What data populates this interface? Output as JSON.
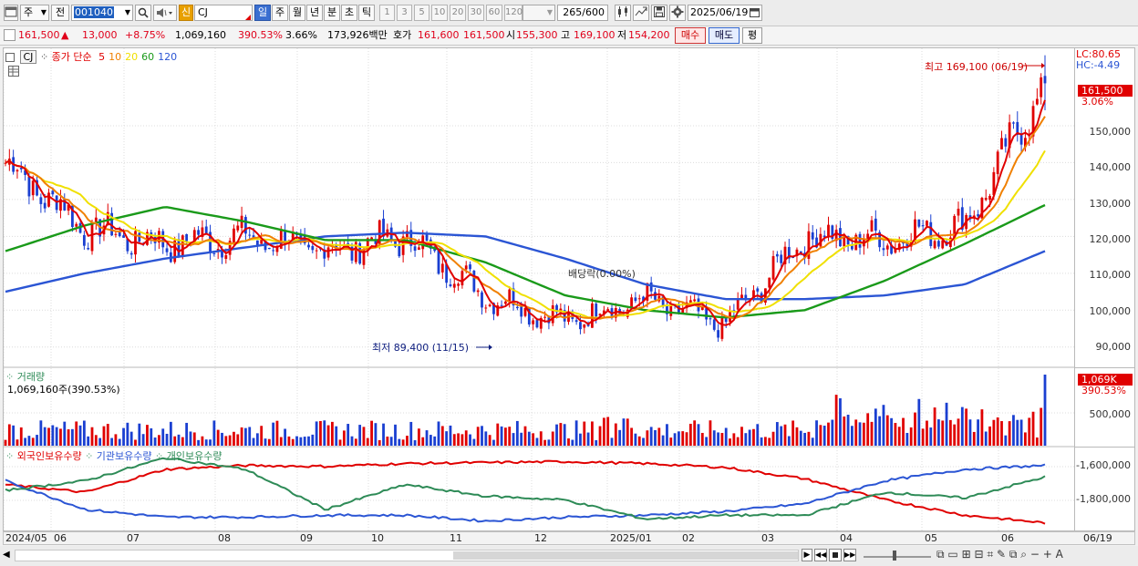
{
  "toolbar": {
    "market_type": "주",
    "prev_label": "전",
    "code_value": "001040",
    "credit_badge": "신",
    "stock_name": "CJ",
    "period_buttons": [
      "일",
      "주",
      "월",
      "년",
      "분",
      "초",
      "틱"
    ],
    "active_period": "일",
    "minute_buttons": [
      "1",
      "3",
      "5",
      "10",
      "20",
      "30",
      "60",
      "120"
    ],
    "count_value": "265",
    "count_total": "/600",
    "date_value": "2025/06/19"
  },
  "quote": {
    "price": "161,500",
    "change_arrow": "▲",
    "change": "13,000",
    "change_pct": "+8.75%",
    "volume": "1,069,160",
    "volume_ratio": "390.53%",
    "turnover": "3.66%",
    "amount": "173,926백만",
    "ask_label": "호가",
    "ask": "161,600",
    "bid": "161,500",
    "open_label": "시",
    "open": "155,300",
    "high_label": "고",
    "high": "169,100",
    "low_label": "저",
    "low": "154,200",
    "buy_button": "매수",
    "sell_button": "매도",
    "eval_button": "평"
  },
  "price_pane": {
    "title_box": "CJ",
    "ma_label": "종가 단순",
    "ma_periods": [
      "5",
      "10",
      "20",
      "60",
      "120"
    ],
    "ma_colors": [
      "#e00000",
      "#f08000",
      "#f0e000",
      "#1a9a1a",
      "#2b55d4"
    ],
    "high_annotation": "최고 169,100 (06/19)",
    "low_annotation": "최저 89,400 (11/15)",
    "mid_annotation": "배당락(0.00%)",
    "lc_label": "LC:80.65",
    "hc_label": "HC:-4.49",
    "current_price_tag": "161,500",
    "current_pct_tag": "3.06%",
    "yticks": [
      "150,000",
      "140,000",
      "130,000",
      "120,000",
      "110,000",
      "100,000",
      "90,000"
    ]
  },
  "volume_pane": {
    "title": "거래량",
    "value_text": "1,069,160주(390.53%)",
    "tag_value": "1,069K",
    "tag_pct": "390.53%",
    "ytick": "500,000"
  },
  "holdings_pane": {
    "series": [
      "외국인보유수량",
      "기관보유수량",
      "개인보유수량"
    ],
    "colors": [
      "#e00000",
      "#2b55d4",
      "#2e8b57"
    ],
    "yticks": [
      "-1,600,000",
      "-1,800,000"
    ]
  },
  "date_axis": {
    "labels": [
      "2024/05",
      "06",
      "07",
      "08",
      "09",
      "10",
      "11",
      "12",
      "2025/01",
      "02",
      "03",
      "04",
      "05",
      "06"
    ],
    "right_label": "06/19"
  },
  "chart_data": {
    "type": "candlestick",
    "title": "CJ",
    "ylabel": "",
    "ylim": [
      85000,
      170000
    ],
    "high": 169100,
    "low": 89400,
    "current": 161500,
    "months": [
      "2024/05",
      "06",
      "07",
      "08",
      "09",
      "10",
      "11",
      "12",
      "2025/01",
      "02",
      "03",
      "04",
      "05",
      "06"
    ],
    "close_monthly": [
      140000,
      122000,
      118000,
      120000,
      116000,
      120000,
      104000,
      97000,
      103000,
      96000,
      120000,
      119000,
      123000,
      161500
    ],
    "ma60_monthly": [
      116000,
      123000,
      128000,
      124000,
      119000,
      119000,
      113000,
      104000,
      100000,
      98000,
      100000,
      108000,
      118000,
      128500
    ],
    "ma120_monthly": [
      105000,
      110000,
      114000,
      117000,
      120000,
      121000,
      120000,
      114000,
      107000,
      103000,
      103000,
      104000,
      107000,
      116000
    ]
  }
}
